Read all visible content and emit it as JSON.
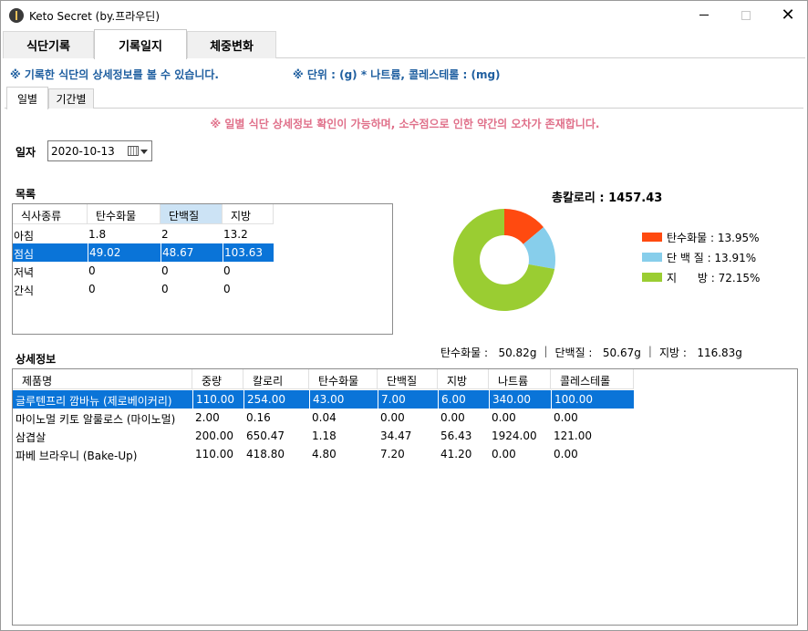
{
  "window": {
    "title": "Keto Secret (by.프라우딘)"
  },
  "main_tabs": [
    {
      "label": "식단기록"
    },
    {
      "label": "기록일지"
    },
    {
      "label": "체중변화"
    }
  ],
  "info": {
    "left": "※ 기록한 식단의 상세정보를 볼 수 있습니다.",
    "right": "※ 단위 : (g)  * 나트륨, 콜레스테롤 : (mg)"
  },
  "sub_tabs": [
    {
      "label": "일별"
    },
    {
      "label": "기간별"
    }
  ],
  "notice": "※ 일별 식단 상세정보 확인이 가능하며, 소수점으로 인한 약간의 오차가 존재합니다.",
  "date": {
    "label": "일자",
    "value": "2020-10-13"
  },
  "list": {
    "label": "목록",
    "headers": [
      "식사종류",
      "탄수화물",
      "단백질",
      "지방"
    ],
    "rows": [
      [
        "아침",
        "1.8",
        "2",
        "13.2"
      ],
      [
        "점심",
        "49.02",
        "48.67",
        "103.63"
      ],
      [
        "저녁",
        "0",
        "0",
        "0"
      ],
      [
        "간식",
        "0",
        "0",
        "0"
      ]
    ]
  },
  "total_calories": "총칼로리 : 1457.43",
  "chart_data": {
    "type": "pie",
    "categories": [
      "탄수화물",
      "단 백 질",
      "지  방"
    ],
    "values": [
      13.95,
      13.91,
      72.15
    ],
    "colors": [
      "#ff4a10",
      "#87ceeb",
      "#9acd32"
    ],
    "legend_labels": [
      "탄수화물 : 13.95%",
      "단 백 질 : 13.91%",
      "지      방 : 72.15%"
    ],
    "legend": "right"
  },
  "totals": {
    "carb": "탄수화물 :   50.82g",
    "protein": "단백질 :   50.67g",
    "fat": "지방 :   116.83g"
  },
  "detail": {
    "label": "상세정보",
    "headers": [
      "제품명",
      "중량",
      "칼로리",
      "탄수화물",
      "단백질",
      "지방",
      "나트륨",
      "콜레스테롤"
    ],
    "rows": [
      [
        "글루텐프리 깜바뉴 (제로베이커리)",
        "110.00",
        "254.00",
        "43.00",
        "7.00",
        "6.00",
        "340.00",
        "100.00"
      ],
      [
        "마이노멀 키토 알룰로스 (마이노멀)",
        "2.00",
        "0.16",
        "0.04",
        "0.00",
        "0.00",
        "0.00",
        "0.00"
      ],
      [
        "삼겹살",
        "200.00",
        "650.47",
        "1.18",
        "34.47",
        "56.43",
        "1924.00",
        "121.00"
      ],
      [
        "파베 브라우니 (Bake-Up)",
        "110.00",
        "418.80",
        "4.80",
        "7.20",
        "41.20",
        "0.00",
        "0.00"
      ]
    ]
  }
}
